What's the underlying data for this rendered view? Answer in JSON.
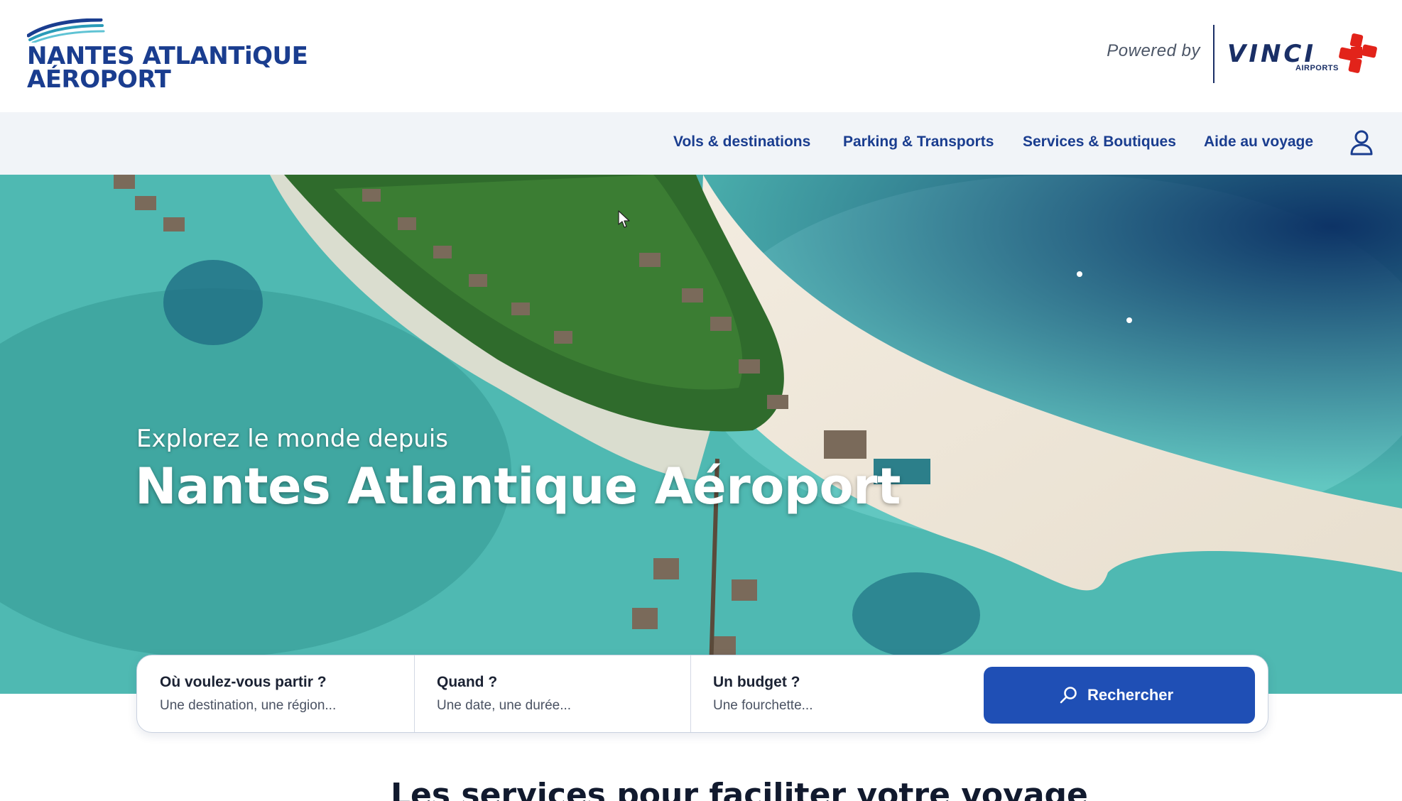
{
  "header": {
    "logo_line1": "NANTES ATLANTiQUE",
    "logo_line2": "AÉROPORT",
    "powered_by": "Powered by",
    "partner_logo_word": "VINCI",
    "partner_logo_sub": "AIRPORTS"
  },
  "nav": {
    "items": [
      {
        "label": "Vols & destinations"
      },
      {
        "label": "Parking & Transports"
      },
      {
        "label": "Services & Boutiques"
      },
      {
        "label": "Aide au voyage"
      }
    ],
    "account_icon": "user-icon"
  },
  "hero": {
    "subtitle": "Explorez le monde depuis",
    "title": "Nantes Atlantique Aéroport"
  },
  "search": {
    "destination": {
      "label": "Où voulez-vous partir ?",
      "placeholder": "Une destination, une région..."
    },
    "date": {
      "label": "Quand ?",
      "placeholder": "Une date, une durée..."
    },
    "budget": {
      "label": "Un budget ?",
      "placeholder": "Une fourchette..."
    },
    "submit_label": "Rechercher",
    "submit_icon": "search-icon"
  },
  "section": {
    "title": "Les services pour faciliter votre voyage"
  },
  "colors": {
    "brand_navy": "#1a3d8f",
    "button_blue": "#1f4fb5",
    "nav_bg": "#f1f4f8",
    "vinci_red": "#e2231a"
  }
}
